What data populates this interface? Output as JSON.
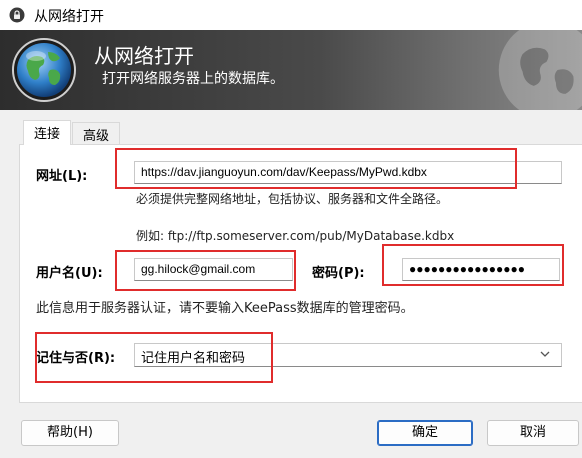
{
  "window": {
    "title": "从网络打开",
    "icon": "lock-icon"
  },
  "banner": {
    "title": "从网络打开",
    "subtitle": "打开网络服务器上的数据库。",
    "icon": "globe-icon"
  },
  "tabs": [
    {
      "label": "连接",
      "active": true
    },
    {
      "label": "高级",
      "active": false
    }
  ],
  "url": {
    "label": "网址(L):",
    "value": "https://dav.jianguoyun.com/dav/Keepass/MyPwd.kdbx",
    "hint": "必须提供完整网络地址，包括协议、服务器和文件全路径。",
    "example": "例如: ftp://ftp.someserver.com/pub/MyDatabase.kdbx"
  },
  "username": {
    "label": "用户名(U):",
    "value": "gg.hilock@gmail.com"
  },
  "password": {
    "label": "密码(P):",
    "value": "●●●●●●●●●●●●●●●●"
  },
  "auth_note": "此信息用于服务器认证，请不要输入KeePass数据库的管理密码。",
  "remember": {
    "label": "记住与否(R):",
    "selected": "记住用户名和密码"
  },
  "buttons": {
    "help": "帮助(H)",
    "ok": "确定",
    "cancel": "取消"
  },
  "colors": {
    "annotation_red": "#e02c2c",
    "primary_border": "#2b6cc4",
    "banner_dark": "#2d2d2d"
  }
}
